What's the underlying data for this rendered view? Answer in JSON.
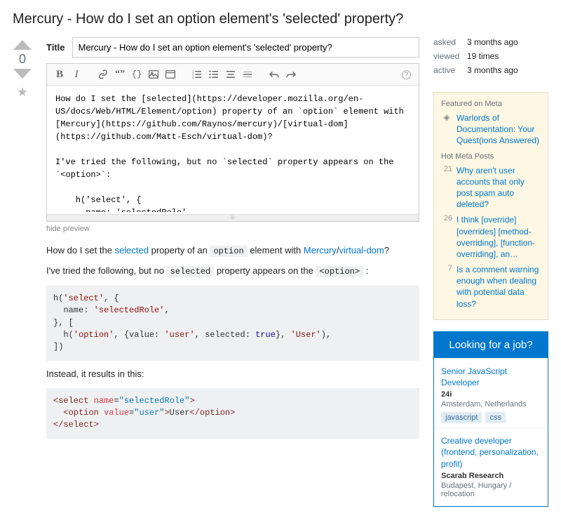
{
  "page_title": "Mercury - How do I set an option element's 'selected' property?",
  "vote_score": "0",
  "title_field": {
    "label": "Title",
    "value": "Mercury - How do I set an option element's 'selected' property?"
  },
  "toolbar": {
    "bold": "B",
    "italic": "I",
    "help": "?"
  },
  "body_raw": "How do I set the [selected](https://developer.mozilla.org/en-US/docs/Web/HTML/Element/option) property of an `option` element with [Mercury](https://github.com/Raynos/mercury)/[virtual-dom](https://github.com/Matt-Esch/virtual-dom)?\n\nI've tried the following, but no `selected` property appears on the `<option>`:\n\n    h('select', {\n      name: 'selectedRole',\n    }, [",
  "hide_preview": "hide preview",
  "preview": {
    "intro_1": "How do I set the ",
    "link_selected": "selected",
    "intro_2": " property of an ",
    "code_option": "option",
    "intro_3": " element with ",
    "link_mercury": "Mercury",
    "slash": "/",
    "link_vdom": "virtual-dom",
    "intro_4": "?",
    "tried_1": "I've tried the following, but no ",
    "code_selected": "selected",
    "tried_2": " property appears on the ",
    "code_option_tag": "<option>",
    "tried_3": " :",
    "instead": "Instead, it results in this:"
  },
  "stats": {
    "asked_label": "asked",
    "asked_value": "3 months ago",
    "viewed_label": "viewed",
    "viewed_value": "19 times",
    "active_label": "active",
    "active_value": "3 months ago"
  },
  "meta": {
    "featured_hdr": "Featured on Meta",
    "featured_link": "Warlords of Documentation: Your Quest(ions Answered)",
    "hot_hdr": "Hot Meta Posts",
    "items": [
      {
        "num": "21",
        "text": "Why aren't user accounts that only post spam auto deleted?"
      },
      {
        "num": "26",
        "text": "I think [override] [overrides] [method-overriding], [function-overriding], an…"
      },
      {
        "num": "7",
        "text": "Is a comment warning enough when dealing with potential data loss?"
      }
    ]
  },
  "jobs": {
    "hdr": "Looking for a job?",
    "items": [
      {
        "title": "Senior JavaScript Developer",
        "company": "24i",
        "location": "Amsterdam, Netherlands",
        "tags": [
          "javascript",
          "css"
        ]
      },
      {
        "title": "Creative developer (frontend, personalization, profit)",
        "company": "Scarab Research",
        "location": "Budapest, Hungary / relocation",
        "tags": []
      }
    ]
  }
}
